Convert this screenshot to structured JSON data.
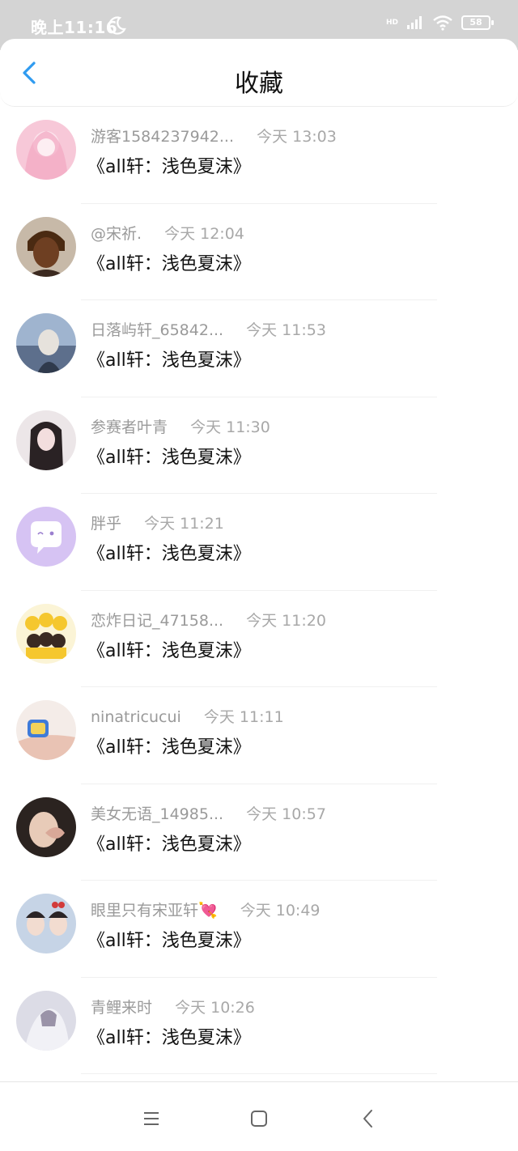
{
  "status": {
    "time": "晚上11:16",
    "battery": "58",
    "network": "HD"
  },
  "header": {
    "title": "收藏"
  },
  "items": [
    {
      "user": "游客1584237942...",
      "time": "今天 13:03",
      "content": "《all轩：浅色夏沫》"
    },
    {
      "user": "@宋祈.",
      "time": "今天 12:04",
      "content": "《all轩：浅色夏沫》"
    },
    {
      "user": "日落屿轩_65842...",
      "time": "今天 11:53",
      "content": "《all轩：浅色夏沫》"
    },
    {
      "user": "参赛者叶青",
      "time": "今天 11:30",
      "content": "《all轩：浅色夏沫》"
    },
    {
      "user": "胖乎",
      "time": "今天 11:21",
      "content": "《all轩：浅色夏沫》"
    },
    {
      "user": "恋炸日记_47158...",
      "time": "今天 11:20",
      "content": "《all轩：浅色夏沫》"
    },
    {
      "user": "ninatricucui",
      "time": "今天 11:11",
      "content": "《all轩：浅色夏沫》"
    },
    {
      "user": "美女无语_14985...",
      "time": "今天 10:57",
      "content": "《all轩：浅色夏沫》"
    },
    {
      "user": "眼里只有宋亚轩💘",
      "time": "今天 10:49",
      "content": "《all轩：浅色夏沫》"
    },
    {
      "user": "青鲤来时",
      "time": "今天 10:26",
      "content": "《all轩：浅色夏沫》"
    }
  ],
  "colors": {
    "accent": "#2f9bf0",
    "status_bar": "#d4d4d4"
  }
}
